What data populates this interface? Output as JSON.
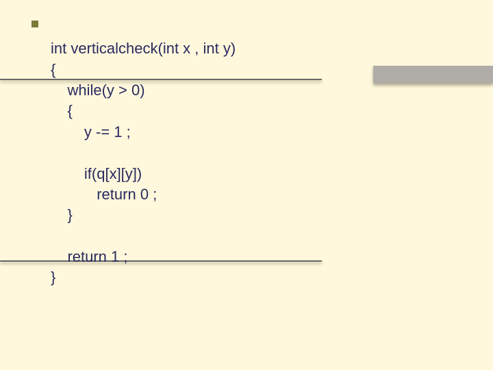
{
  "code": {
    "l1": "int verticalcheck(int x , int y)",
    "l2": "{",
    "l3": "    while(y > 0)",
    "l4": "    {",
    "l5": "        y -= 1 ;",
    "l6": "",
    "l7": "        if(q[x][y])",
    "l8": "           return 0 ;",
    "l9": "    }",
    "l10": "",
    "l11": "    return 1 ;",
    "l12": "}"
  }
}
